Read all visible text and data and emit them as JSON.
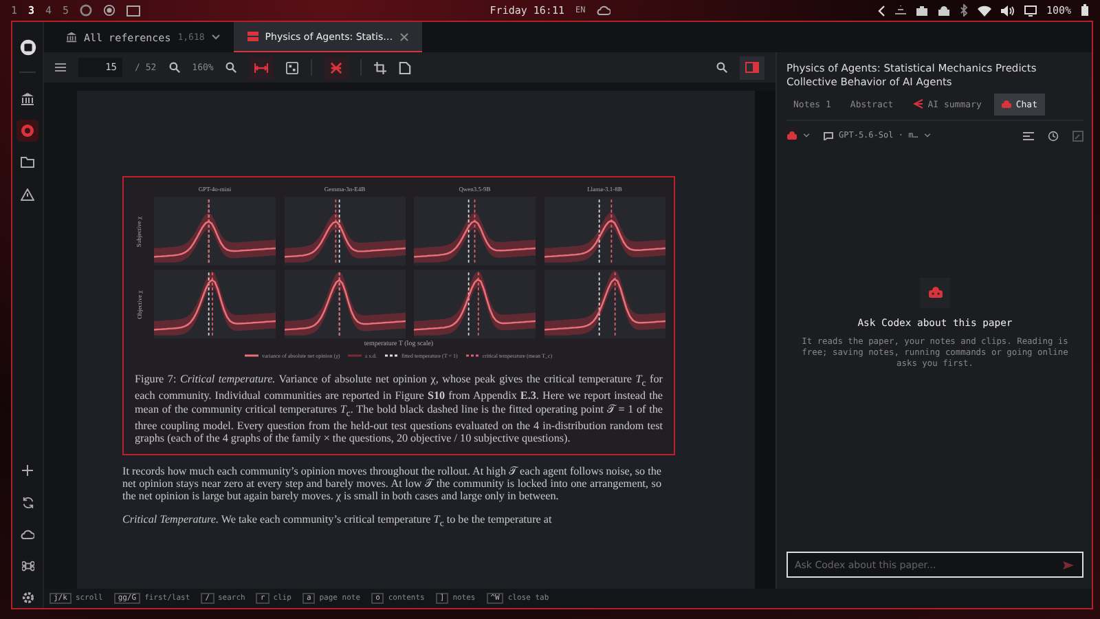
{
  "desktop_bar": {
    "workspaces": [
      {
        "label": "1",
        "selected": false
      },
      {
        "label": "3",
        "selected": true
      },
      {
        "label": "4",
        "selected": false
      },
      {
        "label": "5",
        "selected": false
      }
    ],
    "clock": "Friday 16:11",
    "keyboard": "EN",
    "battery": "100%"
  },
  "rail": {
    "top": [
      {
        "kind": "library",
        "selected": false
      },
      {
        "kind": "record",
        "selected": true
      },
      {
        "kind": "folder",
        "selected": false
      },
      {
        "kind": "warning",
        "selected": false
      }
    ],
    "bottom": [
      {
        "kind": "plus"
      },
      {
        "kind": "sync"
      },
      {
        "kind": "cloud"
      },
      {
        "kind": "command"
      },
      {
        "kind": "settings"
      }
    ]
  },
  "tabs": [
    {
      "label": "All references",
      "count": "1,618",
      "selected": false,
      "closable": false
    },
    {
      "label": "Physics of Agents: Statis…",
      "selected": true,
      "closable": true
    }
  ],
  "toolbar": {
    "page": "15",
    "pages": "/ 52",
    "zoom": "160%"
  },
  "figure": {
    "panels": [
      "GPT-4o-mini",
      "Gemma-3n-E4B",
      "Qwen3.5-9B",
      "Llama-3.1-8B"
    ],
    "row_labels": [
      "Subjective χ",
      "Objective χ"
    ],
    "xlabel": "temperature T (log scale)",
    "legend": [
      "variance of absolute net opinion (χ)",
      "± s.d.",
      "fitted temperature (T = 1)",
      "critical temperature (mean T_c)"
    ],
    "caption": "Figure 7: *Critical temperature.* Variance of absolute net opinion χ, whose peak gives the critical temperature *T*$_{c}$ for each community. Individual communities are reported in Figure **S10** from Appendix **E.3**. Here we report instead the mean of the community critical temperatures *T*$_{c}$. The bold black dashed line is the fitted operating point 𝒯 = 1 of the three coupling model. Every question from the held-out test questions evaluated on the 4 in-distribution random test graphs (each of the 4 graphs of the family × the questions, 20 objective / 10 subjective questions)."
  },
  "body": [
    "It records how much each community’s opinion moves throughout the rollout. At high 𝒯 each agent follows noise, so the net opinion stays near zero at every step and barely moves. At low 𝒯 the community is locked into one arrangement, so the net opinion is large but again barely moves. χ is small in both cases and large only in between.",
    "*Critical Temperature.* We take each community’s critical temperature *T*$_{c}$ to be the temperature at"
  ],
  "shortcuts": [
    {
      "key": "j/k",
      "label": "scroll"
    },
    {
      "key": "gg/G",
      "label": "first/last"
    },
    {
      "key": "/",
      "label": "search"
    },
    {
      "key": "r",
      "label": "clip"
    },
    {
      "key": "a",
      "label": "page note"
    },
    {
      "key": "o",
      "label": "contents"
    },
    {
      "key": "]",
      "label": "notes"
    },
    {
      "key": "^W",
      "label": "close tab"
    }
  ],
  "panel": {
    "title": "Physics of Agents: Statistical Mechanics Predicts Collective Behavior of AI Agents",
    "tabs": [
      {
        "label": "Notes",
        "count": "1",
        "selected": false
      },
      {
        "label": "Abstract",
        "selected": false
      },
      {
        "label": "AI summary",
        "selected": false
      },
      {
        "label": "Chat",
        "selected": true
      }
    ],
    "model": "GPT-5.6-Sol · m…",
    "empty_title": "Ask Codex about this paper",
    "empty_text": "It reads the paper, your notes and clips. Reading is free; saving notes, running commands or going online asks you first.",
    "input": {
      "placeholder": "Ask Codex about this paper..."
    }
  }
}
